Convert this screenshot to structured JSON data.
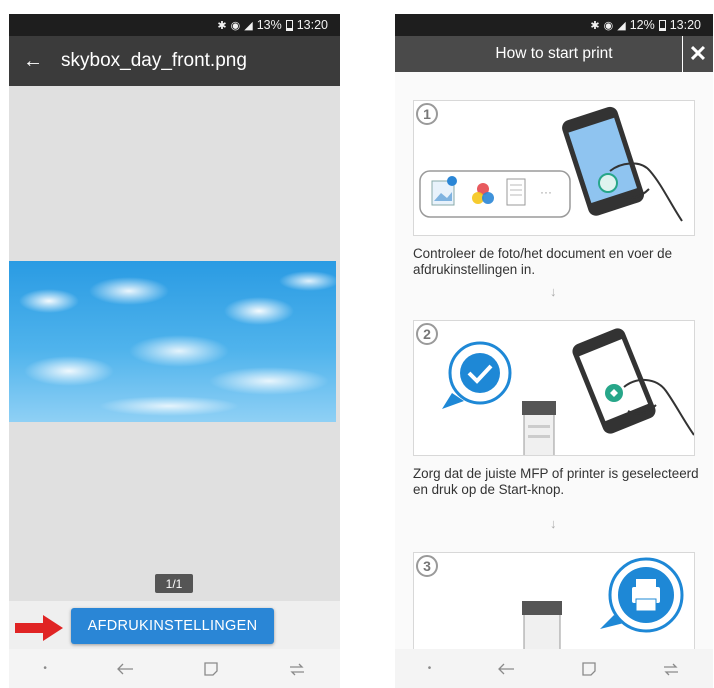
{
  "left_screen": {
    "status": {
      "battery": "13%",
      "time": "13:20"
    },
    "appbar": {
      "title": "skybox_day_front.png"
    },
    "page_counter": "1/1",
    "settings_button": "AFDRUKINSTELLINGEN"
  },
  "right_screen": {
    "status": {
      "battery": "12%",
      "time": "13:20"
    },
    "appbar": {
      "title": "How to start print"
    },
    "steps": [
      {
        "number": "1",
        "text": "Controleer de foto/het document en voer de afdrukinstellingen in."
      },
      {
        "number": "2",
        "text": "Zorg dat de juiste MFP of printer is geselecteerd en druk op de Start-knop."
      },
      {
        "number": "3",
        "text": ""
      }
    ]
  },
  "colors": {
    "accent": "#2a86d6",
    "check": "#1e88d6",
    "teal": "#27a689",
    "arrow": "#e02424"
  }
}
